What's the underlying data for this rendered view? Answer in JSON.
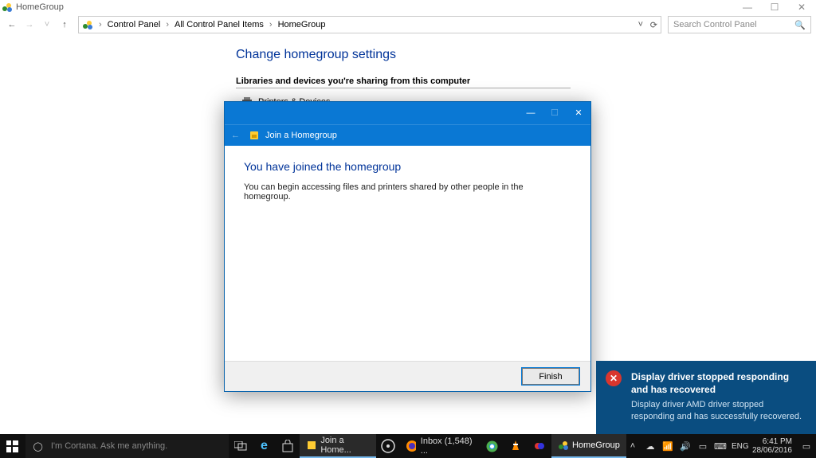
{
  "window": {
    "title": "HomeGroup",
    "controls": {
      "min": "—",
      "max": "☐",
      "close": "✕"
    }
  },
  "nav": {
    "back": "←",
    "fwd": "→",
    "up": "↑",
    "crumbs": [
      "Control Panel",
      "All Control Panel Items",
      "HomeGroup"
    ],
    "refresh": "⟳",
    "search_placeholder": "Search Control Panel"
  },
  "page": {
    "heading": "Change homegroup settings",
    "section": "Libraries and devices you're sharing from this computer",
    "device": "Printers & Devices"
  },
  "dialog": {
    "wizard_title": "Join a Homegroup",
    "heading": "You have joined the homegroup",
    "body": "You can begin accessing files and printers shared by other people in the homegroup.",
    "finish": "Finish"
  },
  "toast": {
    "title": "Display driver stopped responding and has recovered",
    "detail": "Display driver AMD driver stopped responding and has successfully recovered."
  },
  "taskbar": {
    "cortana": "I'm Cortana. Ask me anything.",
    "apps": {
      "join": "Join a Home...",
      "inbox": "Inbox (1,548) ...",
      "homegroup": "HomeGroup"
    },
    "lang": "ENG",
    "time": "6:41 PM",
    "date": "28/06/2016"
  }
}
